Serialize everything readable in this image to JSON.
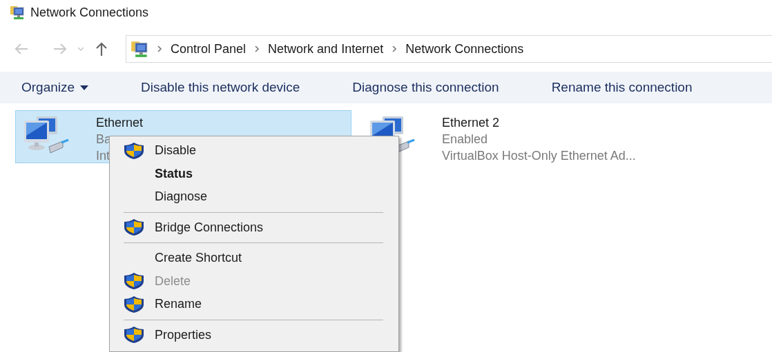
{
  "window": {
    "title": "Network Connections"
  },
  "address_bar": {
    "crumbs": [
      "Control Panel",
      "Network and Internet",
      "Network Connections"
    ]
  },
  "toolbar": [
    {
      "label": "Organize",
      "dropdown": true
    },
    {
      "label": "Disable this network device",
      "dropdown": false
    },
    {
      "label": "Diagnose this connection",
      "dropdown": false
    },
    {
      "label": "Rename this connection",
      "dropdown": false
    }
  ],
  "connections": [
    {
      "name": "Ethernet",
      "status": "Ba",
      "device": "Int",
      "selected": true
    },
    {
      "name": "Ethernet 2",
      "status": "Enabled",
      "device": "VirtualBox Host-Only Ethernet Ad...",
      "selected": false
    }
  ],
  "context_menu": [
    {
      "kind": "item",
      "label": "Disable",
      "shield": true,
      "default": false,
      "disabled": false
    },
    {
      "kind": "item",
      "label": "Status",
      "shield": false,
      "default": true,
      "disabled": false
    },
    {
      "kind": "item",
      "label": "Diagnose",
      "shield": false,
      "default": false,
      "disabled": false
    },
    {
      "kind": "separator"
    },
    {
      "kind": "item",
      "label": "Bridge Connections",
      "shield": true,
      "default": false,
      "disabled": false
    },
    {
      "kind": "separator"
    },
    {
      "kind": "item",
      "label": "Create Shortcut",
      "shield": false,
      "default": false,
      "disabled": false
    },
    {
      "kind": "item",
      "label": "Delete",
      "shield": true,
      "default": false,
      "disabled": true
    },
    {
      "kind": "item",
      "label": "Rename",
      "shield": true,
      "default": false,
      "disabled": false
    },
    {
      "kind": "separator"
    },
    {
      "kind": "item",
      "label": "Properties",
      "shield": true,
      "default": false,
      "disabled": false
    }
  ]
}
